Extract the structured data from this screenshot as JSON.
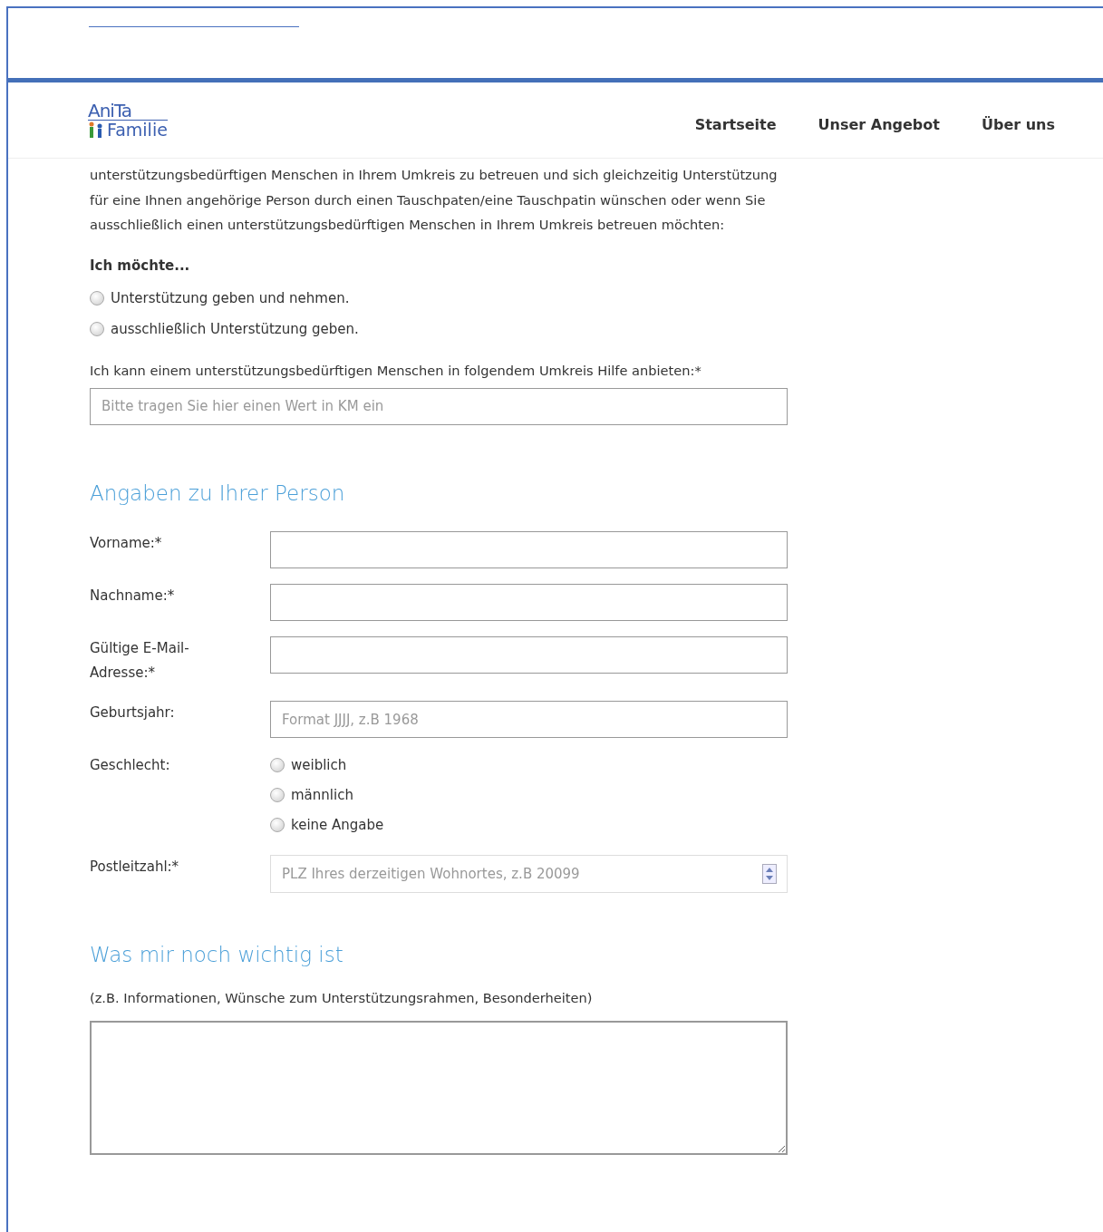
{
  "header": {
    "logo": {
      "line1": "AniTa",
      "line2": "Familie"
    },
    "nav": [
      {
        "label": "Startseite"
      },
      {
        "label": "Unser Angebot"
      },
      {
        "label": "Über uns"
      }
    ]
  },
  "intro": "unterstützungsbedürftigen Menschen in Ihrem Umkreis zu betreuen und sich gleichzeitig Unterstützung für eine Ihnen angehörige Person durch einen Tauschpaten/eine Tauschpatin wünschen oder wenn Sie ausschließlich einen unterstützungsbedürftigen Menschen in Ihrem Umkreis betreuen möchten:",
  "choice": {
    "heading": "Ich möchte...",
    "options": [
      {
        "label": "Unterstützung geben und nehmen.",
        "selected": false
      },
      {
        "label": "ausschließlich Unterstützung geben.",
        "selected": false
      }
    ]
  },
  "radius": {
    "label": "Ich kann einem unterstützungsbedürftigen Menschen in folgendem Umkreis Hilfe anbieten:*",
    "placeholder": "Bitte tragen Sie hier einen Wert in KM ein"
  },
  "person": {
    "title": "Angaben zu Ihrer Person",
    "fields": [
      {
        "kind": "text",
        "label": "Vorname:*"
      },
      {
        "kind": "text",
        "label": "Nachname:*"
      },
      {
        "kind": "text",
        "label": "Gültige E-Mail-Adresse:*"
      },
      {
        "kind": "text",
        "label": "Geburtsjahr:",
        "placeholder": "Format JJJJ, z.B 1968"
      },
      {
        "kind": "radio",
        "label": "Geschlecht:",
        "options": [
          {
            "label": "weiblich",
            "selected": false
          },
          {
            "label": "männlich",
            "selected": false
          },
          {
            "label": "keine Angabe",
            "selected": false
          }
        ]
      },
      {
        "kind": "number",
        "label": "Postleitzahl:*",
        "placeholder": "PLZ Ihres derzeitigen Wohnortes, z.B 20099"
      }
    ]
  },
  "notes": {
    "title": "Was mir noch wichtig ist",
    "hint": "(z.B. Informationen, Wünsche zum Unterstützungsrahmen, Besonderheiten)"
  }
}
